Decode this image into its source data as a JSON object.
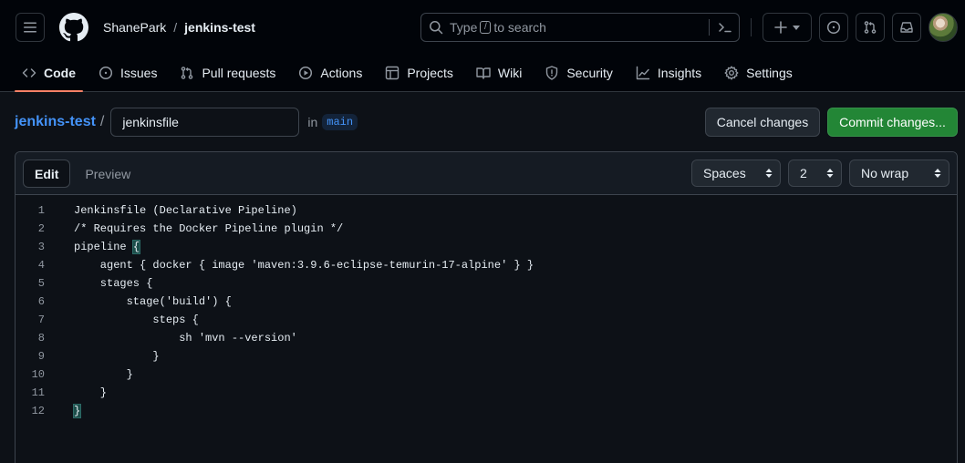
{
  "header": {
    "owner": "ShanePark",
    "separator": "/",
    "repo": "jenkins-test",
    "search": {
      "before": "Type",
      "key": "/",
      "after": "to search"
    }
  },
  "tabs": [
    {
      "label": "Code",
      "icon": "code-icon"
    },
    {
      "label": "Issues",
      "icon": "issue-icon"
    },
    {
      "label": "Pull requests",
      "icon": "pull-request-icon"
    },
    {
      "label": "Actions",
      "icon": "play-icon"
    },
    {
      "label": "Projects",
      "icon": "table-icon"
    },
    {
      "label": "Wiki",
      "icon": "book-icon"
    },
    {
      "label": "Security",
      "icon": "shield-icon"
    },
    {
      "label": "Insights",
      "icon": "graph-icon"
    },
    {
      "label": "Settings",
      "icon": "gear-icon"
    }
  ],
  "editor_bar": {
    "repo_link": "jenkins-test",
    "slash": "/",
    "filename": "jenkinsfile",
    "in_label": "in",
    "branch": "main",
    "cancel_label": "Cancel changes",
    "commit_label": "Commit changes..."
  },
  "editor": {
    "edit_tab": "Edit",
    "preview_tab": "Preview",
    "indent_mode": "Spaces",
    "indent_size": "2",
    "wrap_mode": "No wrap",
    "lines": [
      {
        "n": "1",
        "text": "Jenkinsfile (Declarative Pipeline)"
      },
      {
        "n": "2",
        "text": "/* Requires the Docker Pipeline plugin */"
      },
      {
        "n": "3",
        "text": "pipeline ",
        "brace": "{"
      },
      {
        "n": "4",
        "text": "    agent { docker { image 'maven:3.9.6-eclipse-temurin-17-alpine' } }"
      },
      {
        "n": "5",
        "text": "    stages {"
      },
      {
        "n": "6",
        "text": "        stage('build') {"
      },
      {
        "n": "7",
        "text": "            steps {"
      },
      {
        "n": "8",
        "text": "                sh 'mvn --version'"
      },
      {
        "n": "9",
        "text": "            }"
      },
      {
        "n": "10",
        "text": "        }"
      },
      {
        "n": "11",
        "text": "    }"
      },
      {
        "n": "12",
        "text": "",
        "brace": "}"
      }
    ]
  },
  "colors": {
    "background": "#0d1117",
    "header": "#010409",
    "link": "#4493f8",
    "commit": "#238636",
    "active_tab": "#f78166"
  }
}
